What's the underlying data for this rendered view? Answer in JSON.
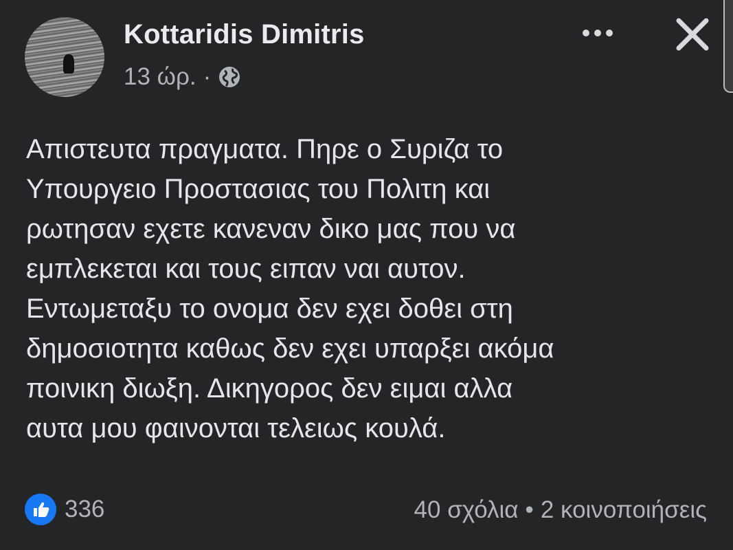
{
  "post": {
    "author": "Kottaridis Dimitris",
    "time": "13 ώρ.",
    "separator": "·",
    "privacy_icon": "globe-icon",
    "text": "Απιστευτα πραγματα. Πηρε ο Συριζα το\nΥπουργειο Προστασιας του Πολιτη και\nρωτησαν εχετε κανεναν δικο μας που να\nεμπλεκεται και τους ειπαν ναι αυτον.\nΕντωμεταξυ το ονομα δεν εχει δοθει στη\nδημοσιοτητα καθως δεν εχει υπαρξει ακόμα\nποινικη διωξη. Δικηγορος δεν ειμαι αλλα\nαυτα μου φαινονται τελειως κουλά."
  },
  "header": {
    "more_icon": "more-icon",
    "close_icon": "close-icon"
  },
  "footer": {
    "like_icon": "like-icon",
    "like_count": "336",
    "comments": "40 σχόλια",
    "dot": "•",
    "shares": "2 κοινοποιήσεις"
  },
  "colors": {
    "background": "#242526",
    "text": "#e4e6eb",
    "secondary": "#b0b3b8",
    "like_blue": "#1877f2"
  }
}
